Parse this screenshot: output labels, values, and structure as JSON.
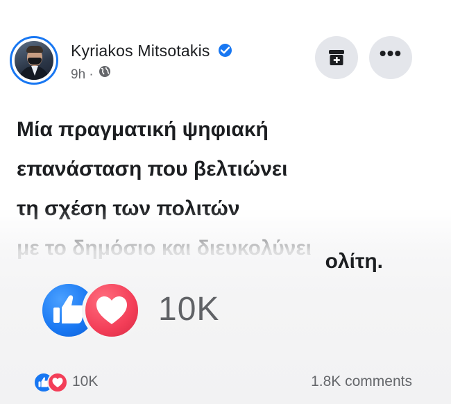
{
  "post": {
    "author": "Kyriakos Mitsotakis",
    "time": "9h",
    "separator": "·",
    "text_lines": [
      "Μία πραγματική ψηφιακή",
      "επανάσταση που βελτιώνει",
      "τη σχέση των πολιτών",
      "με το δημόσιο και διευκολύνει"
    ],
    "last_line_partial": "ολίτη."
  },
  "reactions": {
    "big_count": "10K",
    "count": "10K",
    "comments": "1.8K comments"
  },
  "colors": {
    "brand_blue": "#1877f2",
    "love_red": "#f33e58",
    "button_gray": "#e4e6eb"
  },
  "icons": [
    "verified-badge-icon",
    "globe-icon",
    "save-post-icon",
    "more-options-icon",
    "like-reaction-icon",
    "love-reaction-icon"
  ]
}
